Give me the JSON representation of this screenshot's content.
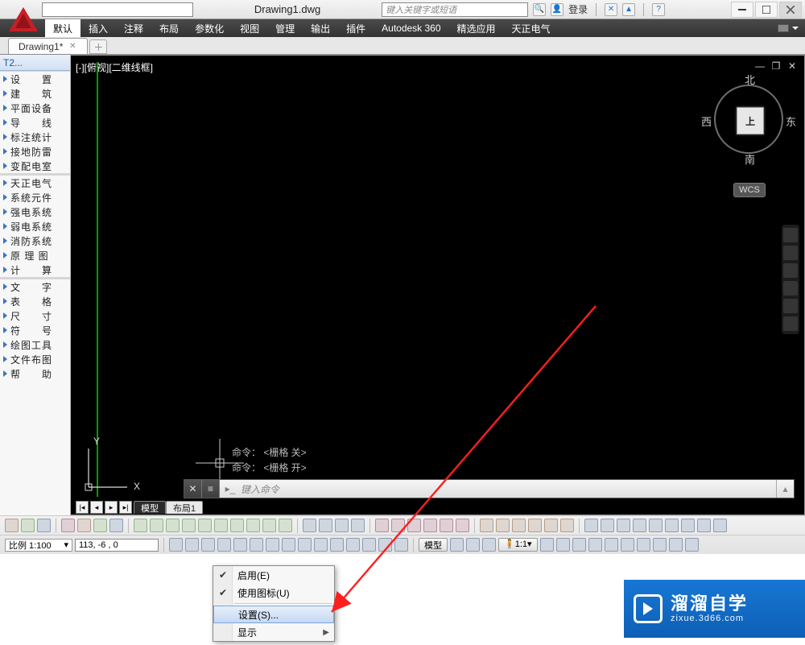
{
  "file_title": "Drawing1.dwg",
  "search_placeholder": "键入关键字或短语",
  "login_label": "登录",
  "menu": {
    "items": [
      "默认",
      "插入",
      "注释",
      "布局",
      "参数化",
      "视图",
      "管理",
      "输出",
      "插件",
      "Autodesk 360",
      "精选应用",
      "天正电气"
    ],
    "active_index": 0
  },
  "doc_tab": "Drawing1*",
  "left_panel": {
    "title": "T2...",
    "groups": [
      [
        "设　　置",
        "建　　筑",
        "平面设备",
        "导　　线",
        "标注统计",
        "接地防雷",
        "变配电室"
      ],
      [
        "天正电气",
        "系统元件",
        "强电系统",
        "弱电系统",
        "消防系统",
        "原 理 图",
        "计　　算"
      ],
      [
        "文　　字",
        "表　　格",
        "尺　　寸",
        "符　　号",
        "绘图工具",
        "文件布图",
        "帮　　助"
      ]
    ]
  },
  "viewport": {
    "label": "[-][俯视][二维线框]",
    "viewcube": {
      "north": "北",
      "south": "南",
      "east": "东",
      "west": "西",
      "face": "上",
      "wcs": "WCS"
    },
    "ucs_x": "X",
    "ucs_y": "Y",
    "cmd_history": [
      "命令：  <栅格 关>",
      "命令：  <栅格 开>"
    ],
    "cmd_prompt_placeholder": "键入命令"
  },
  "model_tabs": {
    "model": "模型",
    "layout1": "布局1"
  },
  "statusbar": {
    "scale_label": "比例 1:100",
    "coords": "113, -6 , 0",
    "modelspace": "模型",
    "ratio": "1:1"
  },
  "context_menu": {
    "items": [
      {
        "label": "启用(E)",
        "checked": true
      },
      {
        "label": "使用图标(U)",
        "checked": true
      },
      {
        "label": "设置(S)...",
        "selected": true
      },
      {
        "label": "显示",
        "submenu": true
      }
    ]
  },
  "watermark": {
    "brand": "溜溜自学",
    "sub": "zixue.3d66.com"
  }
}
